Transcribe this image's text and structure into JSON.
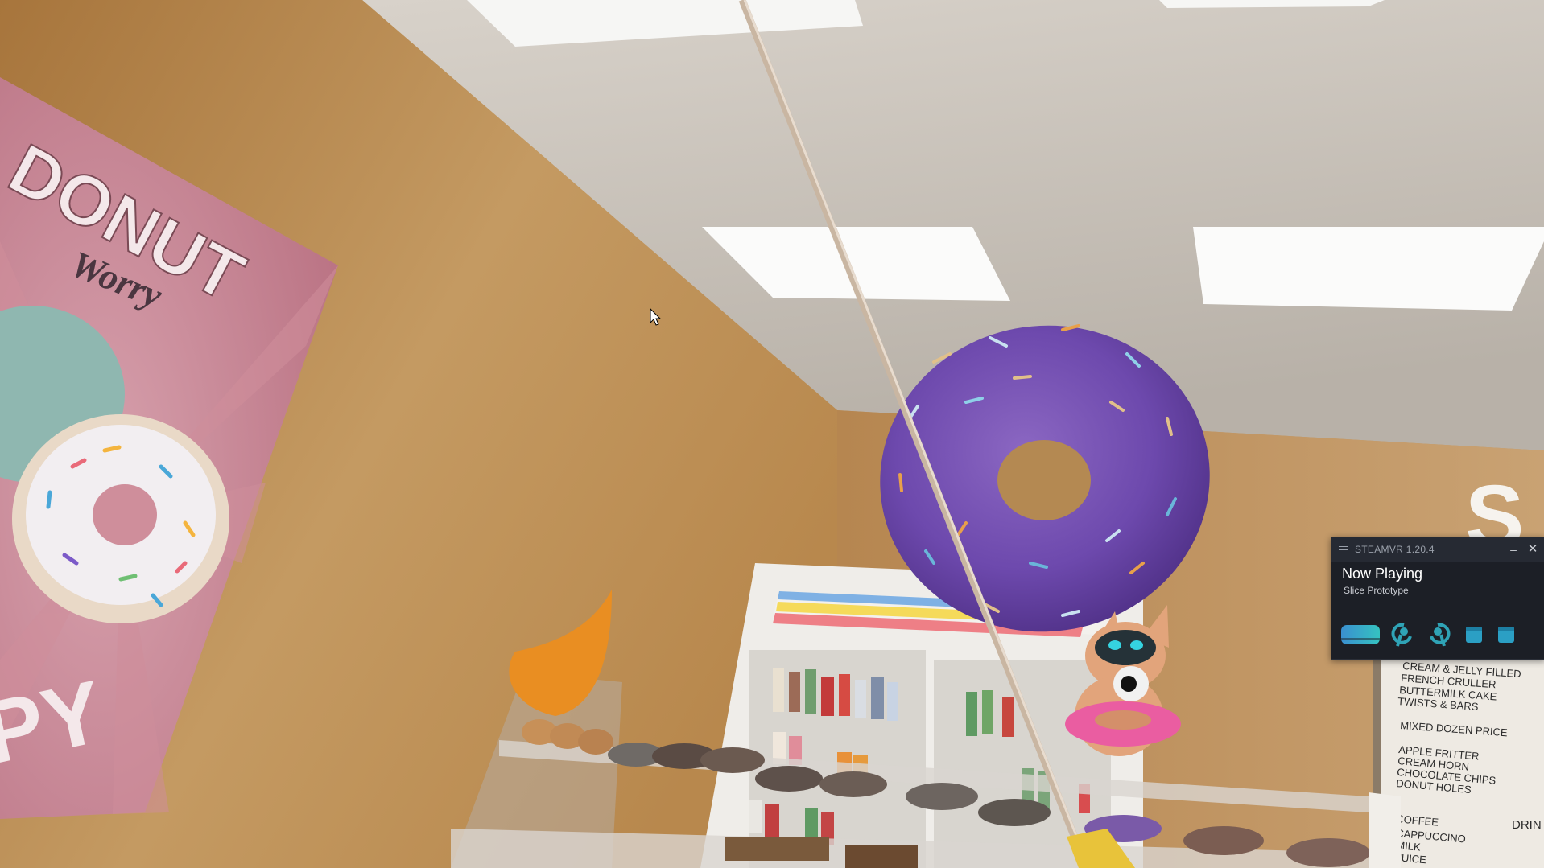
{
  "scene": {
    "poster": {
      "title": "DONUT",
      "subtitle": "Worry",
      "bottom_text": "PY"
    },
    "menu_board": {
      "lines": [
        "CREAM & JELLY FILLED",
        "FRENCH CRULLER",
        "BUTTERMILK CAKE",
        "TWISTS & BARS",
        "MIXED DOZEN PRICE",
        "APPLE FRITTER",
        "CREAM HORN",
        "CHOCOLATE CHIPS",
        "DONUT HOLES",
        "COFFEE",
        "CAPPUCCINO",
        "MILK",
        "JUICE"
      ],
      "side_label": "DRIN",
      "sign_letter": "S"
    }
  },
  "steamvr": {
    "title": "STEAMVR 1.20.4",
    "now_playing_label": "Now Playing",
    "app_name": "Slice Prototype",
    "minimize_icon": "minimize-icon",
    "close_icon": "close-icon",
    "devices": [
      "headset-icon",
      "controller-left-icon",
      "controller-right-icon",
      "base-station-icon",
      "base-station-icon"
    ],
    "accent_color": "#2fa3b6"
  }
}
